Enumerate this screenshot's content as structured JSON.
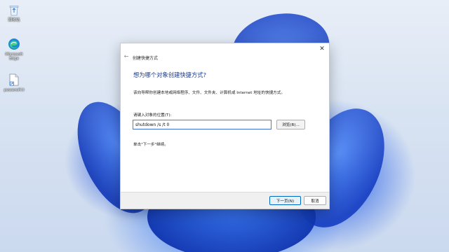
{
  "desktop": {
    "icons": [
      {
        "label": "回收站",
        "icon": "recycle-bin-icon"
      },
      {
        "label": "Microsoft Edge",
        "icon": "edge-icon"
      },
      {
        "label": "poweroff.ll",
        "icon": "shortcut-file-icon"
      }
    ]
  },
  "dialog": {
    "title": "创建快捷方式",
    "back_icon": "←",
    "close_icon": "✕",
    "heading": "想为哪个对象创建快捷方式?",
    "intro": "该向导帮你创建本地或网络程序、文件、文件夹、计算机或 Internet 地址的快捷方式。",
    "field_label": "请键入对象的位置(T):",
    "location_value": "shutdown /s /t 0",
    "browse_label": "浏览(R)...",
    "hint": "单击\"下一步\"继续。",
    "next_label": "下一页(N)",
    "cancel_label": "取消"
  },
  "colors": {
    "accent": "#0067c0",
    "heading": "#1b3a8c"
  }
}
